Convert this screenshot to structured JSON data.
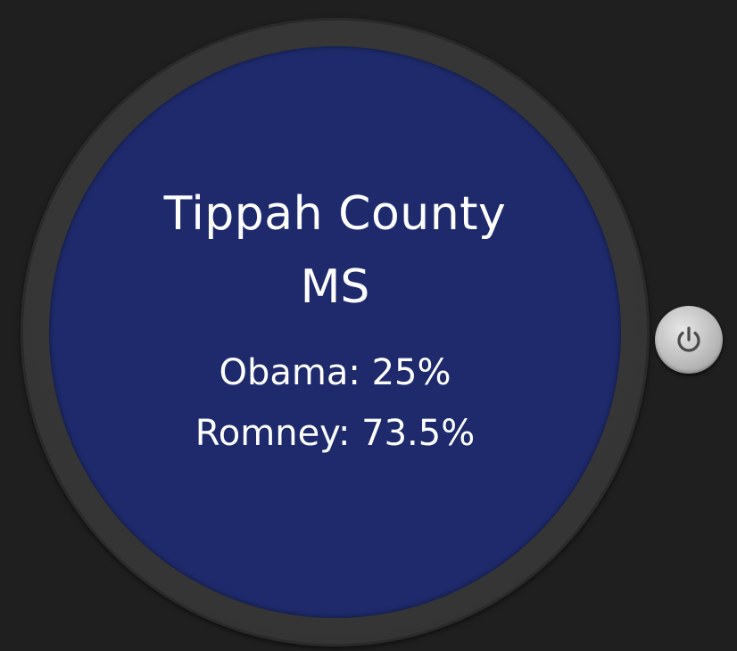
{
  "watch": {
    "screen_color": "#1e2a6b",
    "county": "Tippah County",
    "state": "MS",
    "obama": "Obama: 25%",
    "romney": "Romney: 73.5%"
  },
  "controls": {
    "power_icon": "power-icon"
  }
}
